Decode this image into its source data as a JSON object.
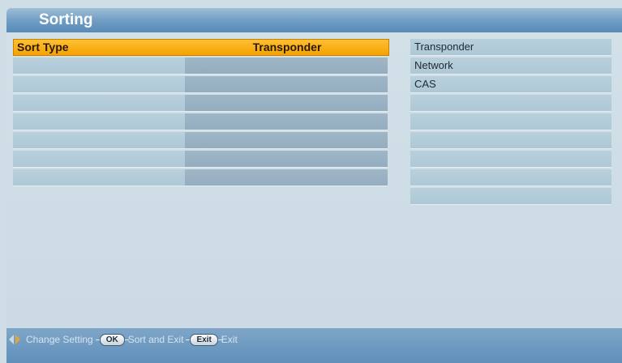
{
  "window": {
    "title": "Sorting"
  },
  "settings": {
    "selected_row": {
      "label": "Sort Type",
      "value": "Transponder"
    },
    "empty_rows": 7
  },
  "options": [
    "Transponder",
    "Network",
    "CAS",
    "",
    "",
    "",
    "",
    "",
    ""
  ],
  "footer": {
    "change_label": "Change Setting",
    "ok_key": "OK",
    "ok_label": "Sort and Exit",
    "exit_key": "Exit",
    "exit_label": "Exit"
  },
  "colors": {
    "highlight": "#f5a200",
    "title_bar": "#6d9bc3",
    "footer_bar": "#6f99c1",
    "panel": "#cfdde6"
  },
  "icons": {
    "left_right": "left-right-arrow-icon"
  }
}
